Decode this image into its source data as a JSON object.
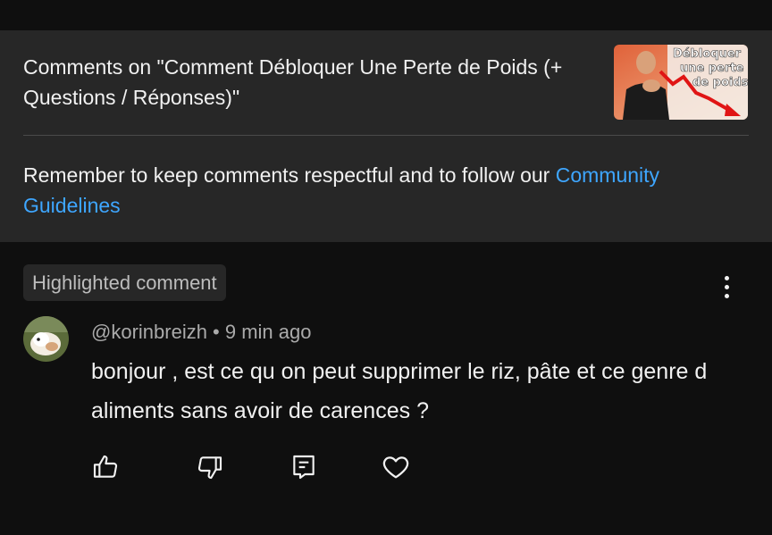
{
  "header": {
    "title": "Comments on \"Comment Débloquer Une Perte de Poids (+ Questions / Réponses)\"",
    "thumbnail_text": [
      "Débloquer",
      "une perte",
      "de poids"
    ],
    "guidelines_text": "Remember to keep comments respectful and to follow our ",
    "guidelines_link": "Community Guidelines"
  },
  "comment": {
    "badge": "Highlighted comment",
    "author": "@korinbreizh",
    "separator": " • ",
    "time": "9 min ago",
    "text": "bonjour , est ce qu on peut supprimer le riz, pâte et ce genre d aliments sans avoir de carences ?"
  },
  "actions": [
    "like-icon",
    "dislike-icon",
    "reply-icon",
    "heart-icon"
  ],
  "colors": {
    "background": "#0f0f0f",
    "panel": "#272727",
    "link": "#3ea6ff",
    "text": "#f1f1f1",
    "secondary": "#aaaaaa"
  }
}
